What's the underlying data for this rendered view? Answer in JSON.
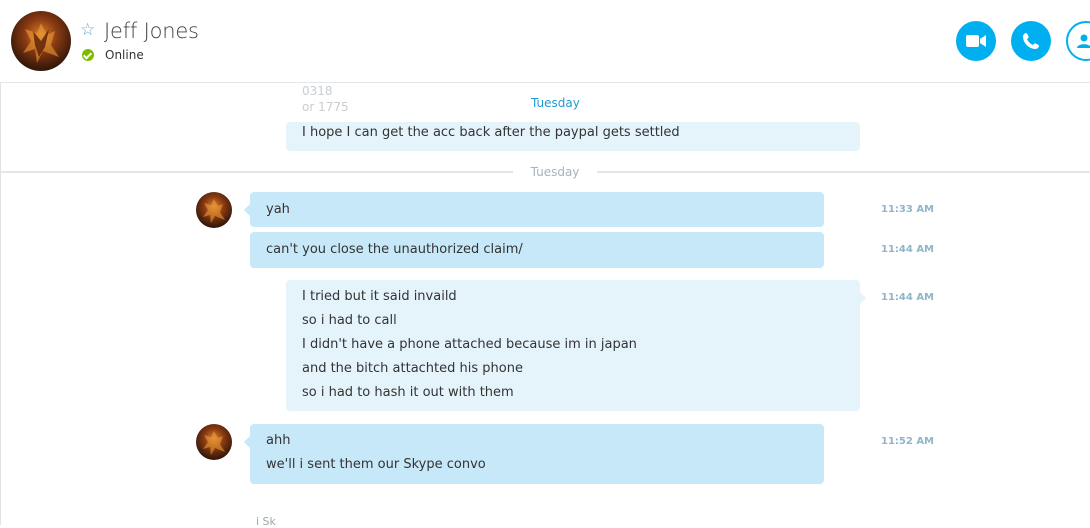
{
  "header": {
    "contact_name": "Jeff Jones",
    "status": "Online",
    "status_color": "#7fba00",
    "accent_color": "#00aff0",
    "favorite_icon": "star-icon",
    "buttons": [
      {
        "name": "video-call-button",
        "icon": "video-camera-icon"
      },
      {
        "name": "audio-call-button",
        "icon": "phone-icon"
      },
      {
        "name": "add-contact-button",
        "icon": "add-person-icon"
      }
    ]
  },
  "conversation": {
    "top_date": "Tuesday",
    "faded_lines": [
      "0318",
      "or 1775"
    ],
    "top_message": "I hope I can get the acc back after the paypal gets settled",
    "date_separator": "Tuesday",
    "messages": [
      {
        "sender": "contact",
        "lines": [
          "yah"
        ],
        "time": "11:33 AM"
      },
      {
        "sender": "contact",
        "lines": [
          "can't you close the unauthorized claim/"
        ],
        "time": "11:44 AM"
      },
      {
        "sender": "self",
        "lines": [
          "I tried but it said invaild",
          "so i had to call",
          "I didn't have a phone attached because im in japan",
          "and the bitch attachted his phone",
          "so i had to hash it out with them"
        ],
        "time": "11:44 AM"
      },
      {
        "sender": "contact",
        "lines": [
          "ahh",
          "we'll i sent them our Skype convo"
        ],
        "time": "11:52 AM"
      }
    ],
    "bottom_hint": "i Sk"
  }
}
